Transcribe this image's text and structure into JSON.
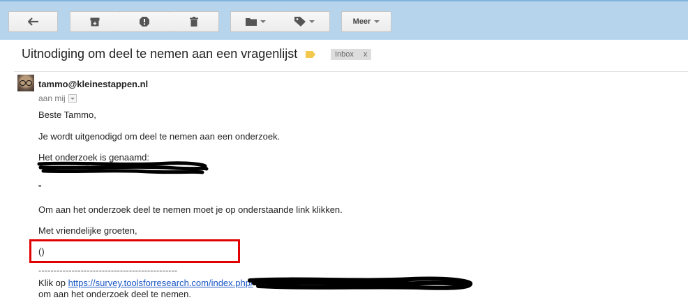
{
  "toolbar": {
    "back_icon": "reply-arrow-icon",
    "archive_icon": "archive-icon",
    "spam_icon": "report-spam-icon",
    "delete_icon": "trash-icon",
    "move_icon": "folder-icon",
    "labels_icon": "label-tag-icon",
    "more_label": "Meer"
  },
  "email": {
    "subject": "Uitnodiging om deel te nemen aan een vragenlijst",
    "label_chip": "Inbox",
    "label_chip_close": "x",
    "sender": "tammo@kleinestappen.nl",
    "to": "aan mij",
    "body": {
      "greeting": "Beste Tammo,",
      "invite": "Je wordt uitgenodigd om deel te nemen aan een onderzoek.",
      "name_intro": "Het onderzoek is genaamd:",
      "quote_close": "\"",
      "instruction": "Om aan het onderzoek deel te nemen moet je op onderstaande link klikken.",
      "closing": "Met vriendelijke groeten,",
      "signature": "()",
      "divider": "----------------------------------------------",
      "click_prefix": "Klik op ",
      "url": "https://survey.toolsforresearch.com/index.php/",
      "click_suffix": "om aan het onderzoek deel te nemen."
    }
  },
  "colors": {
    "toolbar_bg": "#b6d4ec",
    "highlight_border": "#e00000",
    "link": "#1a57c4",
    "label_tag": "#f2c94c"
  }
}
